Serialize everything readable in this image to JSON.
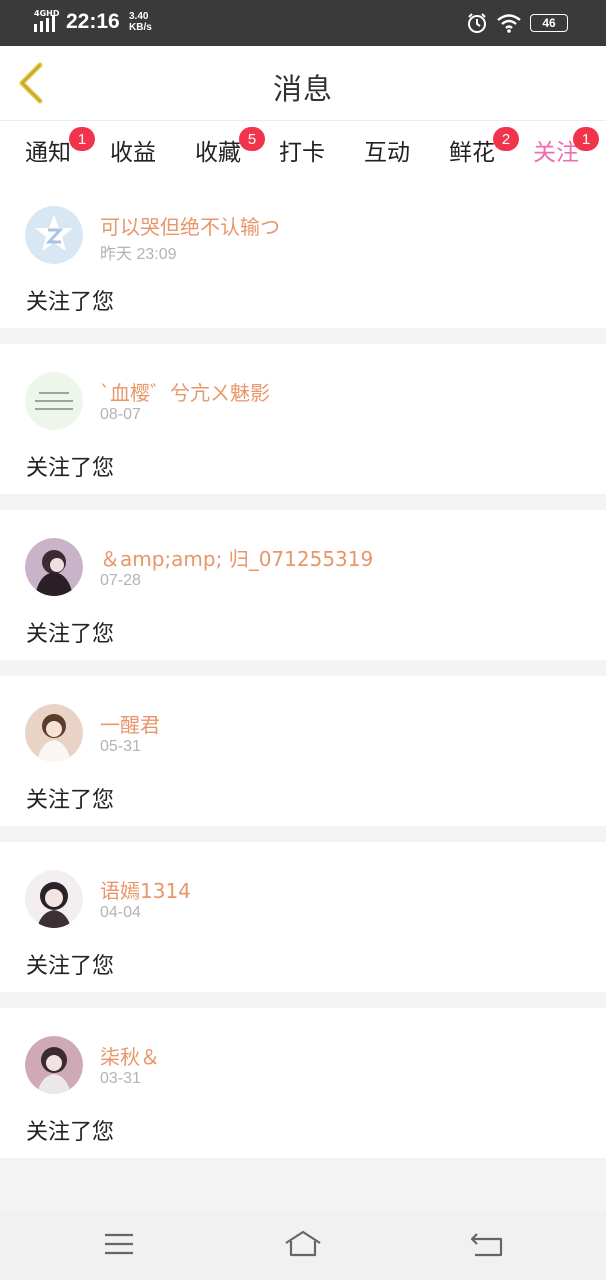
{
  "status_bar": {
    "network": "4GHD",
    "time": "22:16",
    "speed_value": "3.40",
    "speed_unit": "KB/s",
    "battery": "46",
    "icons": [
      "alarm-clock-icon",
      "wifi-icon",
      "battery-icon"
    ]
  },
  "header": {
    "title": "消息",
    "back_icon": "chevron-left-icon",
    "back_color": "#e6c441"
  },
  "tabs": [
    {
      "label": "通知",
      "badge": "1"
    },
    {
      "label": "收益",
      "badge": ""
    },
    {
      "label": "收藏",
      "badge": "5"
    },
    {
      "label": "打卡",
      "badge": ""
    },
    {
      "label": "互动",
      "badge": ""
    },
    {
      "label": "鲜花",
      "badge": "2"
    },
    {
      "label": "关注",
      "badge": "1",
      "active": true
    }
  ],
  "follows": [
    {
      "username": "可以哭但绝不认输つ",
      "time": "昨天 23:09",
      "action": "关注了您"
    },
    {
      "username": "ˋ血樱゛兮亢ㄨ魅影",
      "time": "08-07",
      "action": "关注了您"
    },
    {
      "username": "＆amp;amp; 归_071255319",
      "time": "07-28",
      "action": "关注了您"
    },
    {
      "username": "一醒君",
      "time": "05-31",
      "action": "关注了您"
    },
    {
      "username": "语嫣1314",
      "time": "04-04",
      "action": "关注了您"
    },
    {
      "username": "柒秋＆",
      "time": "03-31",
      "action": "关注了您"
    }
  ],
  "colors": {
    "accent": "#f06cae",
    "badge": "#f2334c",
    "username": "#e8966a"
  },
  "navbar": {
    "icons": [
      "menu-icon",
      "home-icon",
      "back-icon"
    ]
  }
}
